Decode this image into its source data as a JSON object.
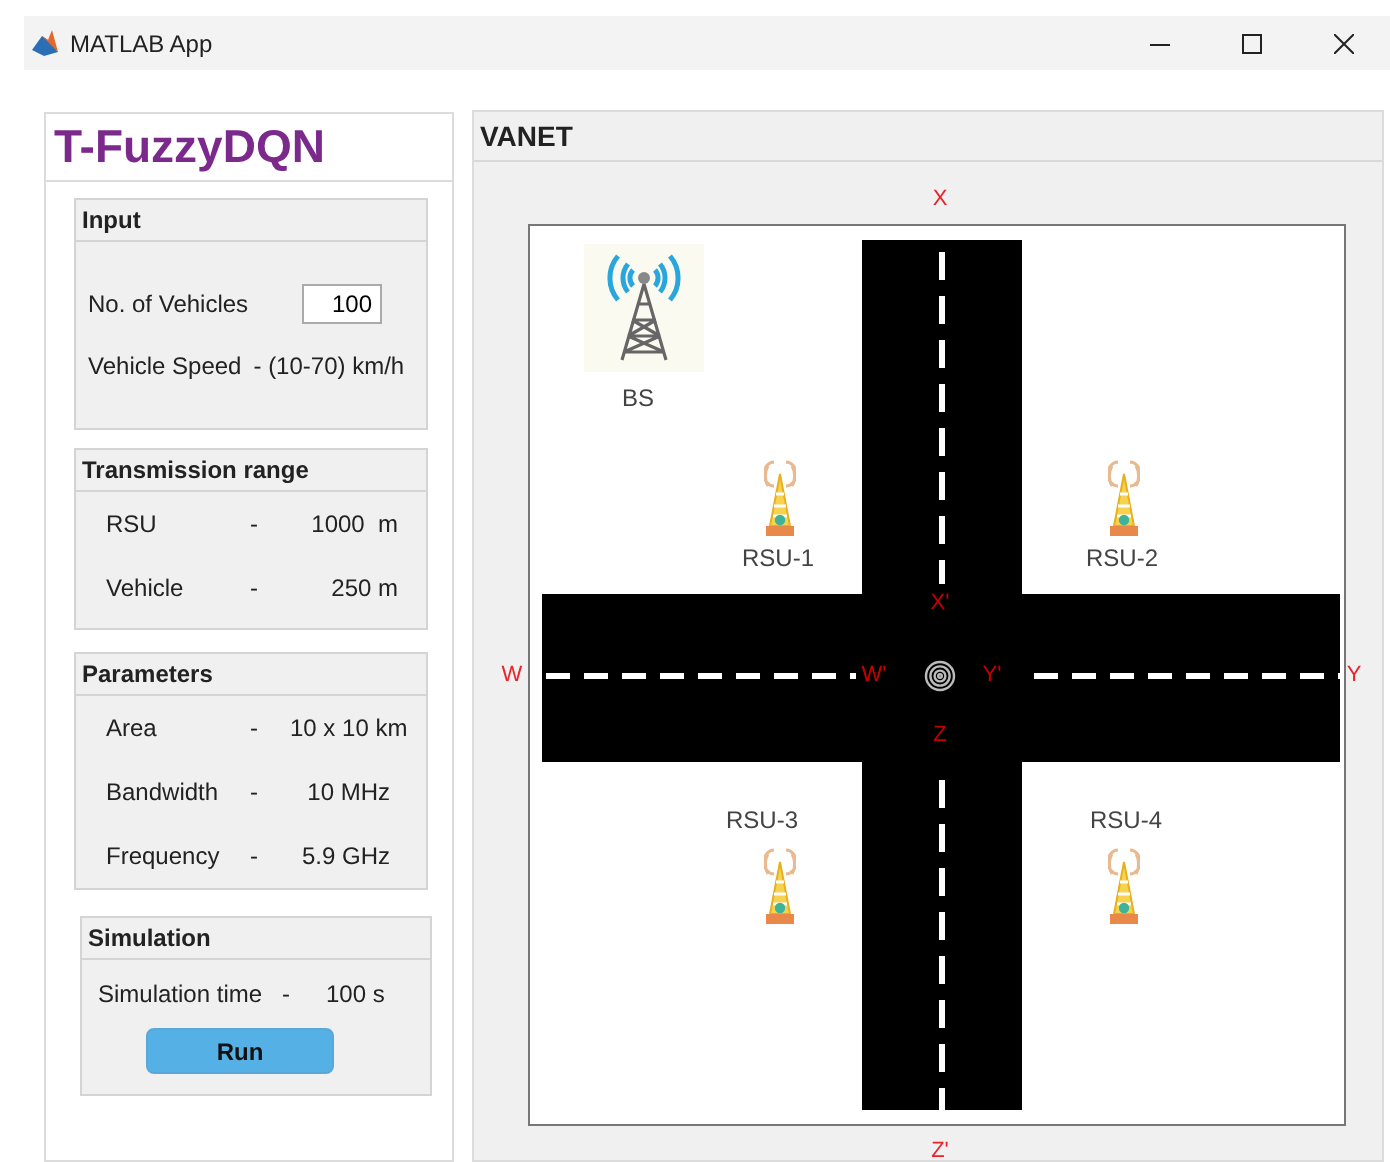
{
  "window": {
    "title": "MATLAB App"
  },
  "app_title": "T-FuzzyDQN",
  "input": {
    "title": "Input",
    "vehicles": {
      "label": "No. of Vehicles",
      "value": "100"
    },
    "speed": {
      "label": "Vehicle Speed",
      "value": "- (10-70) km/h"
    }
  },
  "transmission": {
    "title": "Transmission range",
    "rows": [
      {
        "label": "RSU",
        "dash": "-",
        "value": "1000  m"
      },
      {
        "label": "Vehicle",
        "dash": "-",
        "value": "250 m"
      }
    ]
  },
  "parameters": {
    "title": "Parameters",
    "rows": [
      {
        "label": "Area",
        "dash": "-",
        "value": "10 x 10 km"
      },
      {
        "label": "Bandwidth",
        "dash": "-",
        "value": "10 MHz"
      },
      {
        "label": "Frequency",
        "dash": "-",
        "value": "5.9 GHz"
      }
    ]
  },
  "simulation": {
    "title": "Simulation",
    "rows": [
      {
        "label": "Simulation time",
        "dash": "-",
        "value": "100 s"
      }
    ],
    "button": "Run"
  },
  "vanet": {
    "title": "VANET",
    "axis_labels": [
      "X",
      "X'",
      "W",
      "W'",
      "Y'",
      "Y",
      "Z",
      "Z'"
    ],
    "nodes": [
      {
        "kind": "bs",
        "label": "BS"
      },
      {
        "kind": "rsu",
        "label": "RSU-1"
      },
      {
        "kind": "rsu",
        "label": "RSU-2"
      },
      {
        "kind": "rsu",
        "label": "RSU-3"
      },
      {
        "kind": "rsu",
        "label": "RSU-4"
      }
    ]
  }
}
